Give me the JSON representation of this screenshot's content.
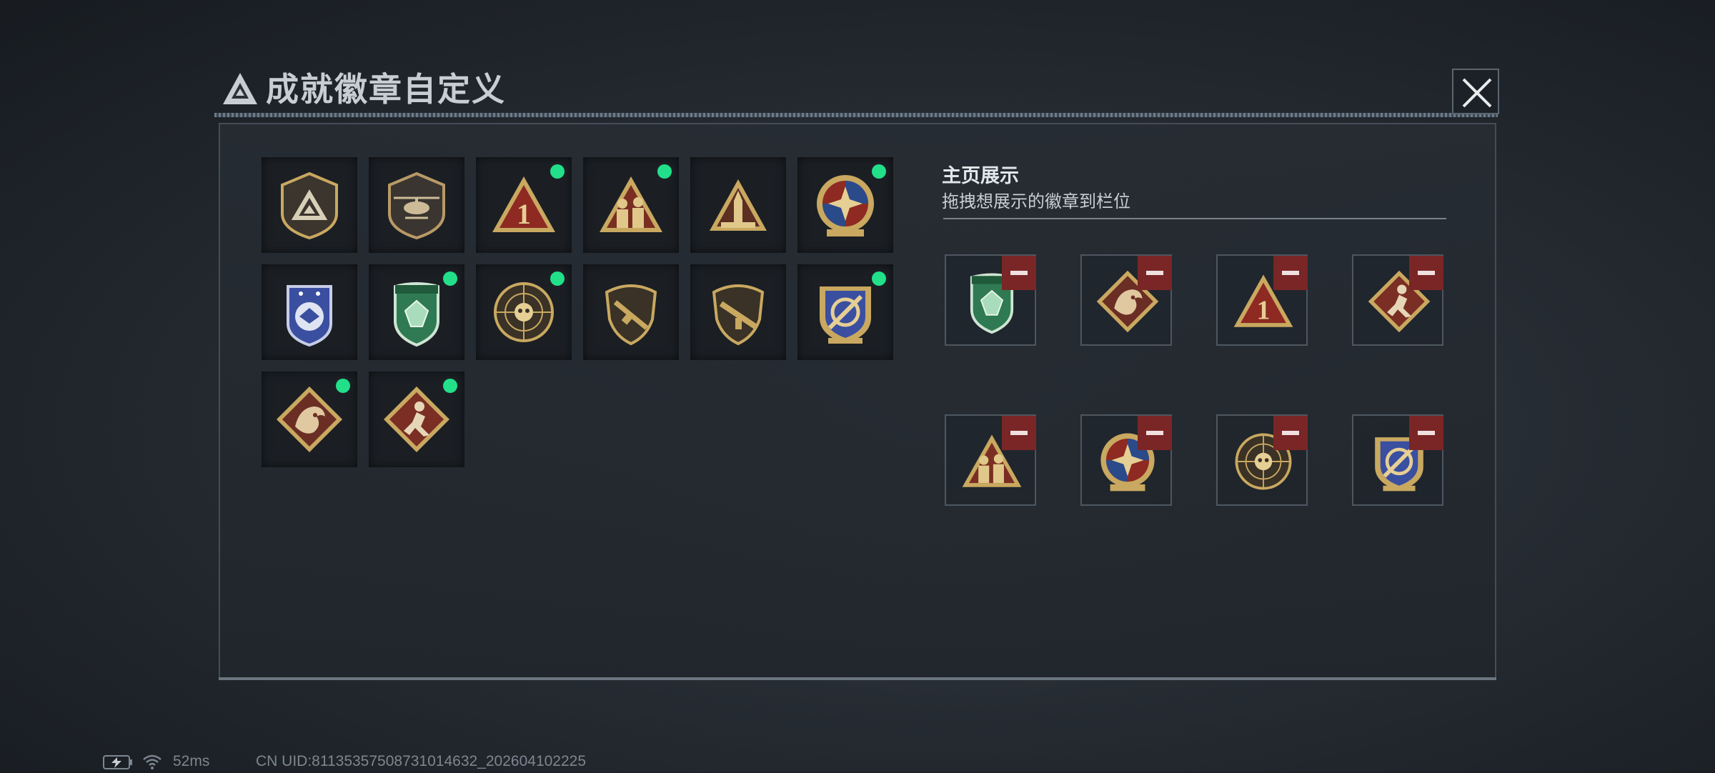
{
  "window": {
    "title": "成就徽章自定义",
    "close_icon": "close-icon"
  },
  "showcase": {
    "title": "主页展示",
    "subtitle": "拖拽想展示的徽章到栏位"
  },
  "colors": {
    "new_dot": "#22e08a",
    "remove_button": "#7a2626",
    "gold": "#c9a860",
    "accent_blue": "#3a6fd8"
  },
  "inventory": [
    {
      "icon": "triangle-logo-shield-badge",
      "new": false
    },
    {
      "icon": "helicopter-shield-badge",
      "new": false
    },
    {
      "icon": "number-one-triangle-badge",
      "new": true
    },
    {
      "icon": "soldiers-triangle-badge",
      "new": true
    },
    {
      "icon": "rocket-triangle-badge",
      "new": false
    },
    {
      "icon": "star-compass-medal-badge",
      "new": true
    },
    {
      "icon": "blue-eagle-shield-badge",
      "new": false
    },
    {
      "icon": "green-gem-shield-badge",
      "new": true
    },
    {
      "icon": "skull-crosshair-badge",
      "new": true
    },
    {
      "icon": "rifle-shield-badge",
      "new": false
    },
    {
      "icon": "assault-rifle-shield-badge",
      "new": false
    },
    {
      "icon": "crossed-swords-shield-badge",
      "new": true
    },
    {
      "icon": "dragon-diamond-badge",
      "new": true
    },
    {
      "icon": "runner-diamond-badge",
      "new": true
    }
  ],
  "slots": [
    {
      "icon": "green-gem-shield-badge",
      "remove_icon": "minus-icon"
    },
    {
      "icon": "dragon-diamond-badge",
      "remove_icon": "minus-icon"
    },
    {
      "icon": "number-one-triangle-badge",
      "remove_icon": "minus-icon"
    },
    {
      "icon": "runner-diamond-badge",
      "remove_icon": "minus-icon"
    },
    {
      "icon": "soldiers-triangle-badge",
      "remove_icon": "minus-icon"
    },
    {
      "icon": "star-compass-medal-badge",
      "remove_icon": "minus-icon"
    },
    {
      "icon": "skull-crosshair-badge",
      "remove_icon": "minus-icon"
    },
    {
      "icon": "crossed-swords-shield-badge",
      "remove_icon": "minus-icon"
    }
  ],
  "status": {
    "ping": "52ms",
    "uid": "CN UID:81135357508731014632_202604102225",
    "battery_icon": "battery-charging-icon",
    "wifi_icon": "wifi-icon"
  }
}
